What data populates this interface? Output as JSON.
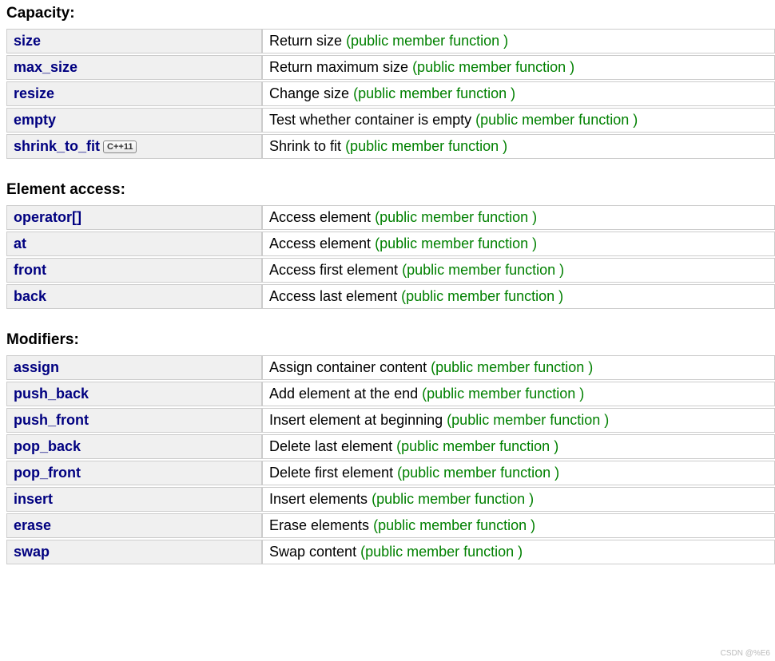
{
  "public_member_fn": "(public member function )",
  "cpp11_badge": "C++11",
  "watermark": "CSDN @%E6",
  "sections": [
    {
      "title": "Capacity:",
      "rows": [
        {
          "name": "size",
          "badge": false,
          "desc": "Return size"
        },
        {
          "name": "max_size",
          "badge": false,
          "desc": "Return maximum size"
        },
        {
          "name": "resize",
          "badge": false,
          "desc": "Change size"
        },
        {
          "name": "empty",
          "badge": false,
          "desc": "Test whether container is empty"
        },
        {
          "name": "shrink_to_fit",
          "badge": true,
          "desc": "Shrink to fit"
        }
      ]
    },
    {
      "title": "Element access:",
      "rows": [
        {
          "name": "operator[]",
          "badge": false,
          "desc": "Access element"
        },
        {
          "name": "at",
          "badge": false,
          "desc": "Access element"
        },
        {
          "name": "front",
          "badge": false,
          "desc": "Access first element"
        },
        {
          "name": "back",
          "badge": false,
          "desc": "Access last element"
        }
      ]
    },
    {
      "title": "Modifiers:",
      "rows": [
        {
          "name": "assign",
          "badge": false,
          "desc": "Assign container content"
        },
        {
          "name": "push_back",
          "badge": false,
          "desc": "Add element at the end"
        },
        {
          "name": "push_front",
          "badge": false,
          "desc": "Insert element at beginning"
        },
        {
          "name": "pop_back",
          "badge": false,
          "desc": "Delete last element"
        },
        {
          "name": "pop_front",
          "badge": false,
          "desc": "Delete first element"
        },
        {
          "name": "insert",
          "badge": false,
          "desc": "Insert elements"
        },
        {
          "name": "erase",
          "badge": false,
          "desc": "Erase elements"
        },
        {
          "name": "swap",
          "badge": false,
          "desc": "Swap content"
        }
      ]
    }
  ]
}
